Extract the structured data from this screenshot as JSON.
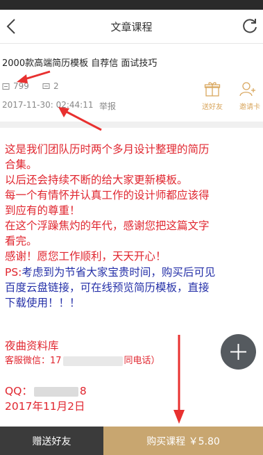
{
  "header": {
    "title": "文章课程",
    "back_icon": "chevron-left-icon",
    "refresh_icon": "refresh-icon"
  },
  "course": {
    "title": "2000款高端简历模板 自荐信 面试技巧",
    "views": "799",
    "comments": "2",
    "datetime": "2017-11-30: 02:44:11",
    "report": "举报",
    "gift_label": "送好友",
    "invite_label": "邀请卡"
  },
  "content": {
    "line1": "这是我们团队历时两个多月设计整理的简历",
    "line2": "合集。",
    "line3": "以后还会持续不断的给大家更新模板。",
    "line4": "每一个有情怀并认真工作的设计师都应该得",
    "line5": "到应有的尊重！",
    "line6": "在这个浮躁焦灼的年代，感谢您把这篇文字",
    "line7": "看完。",
    "line8": "感谢！愿您工作顺利，天天开心！",
    "ps_prefix": "PS:",
    "ps_line1": "考虑到为节省大家宝贵时间，购买后可见",
    "ps_line2": "百度云盘链接，可在线预览简历模板，直接",
    "ps_line3": "下载使用！！！",
    "shop_name": "夜曲资料库",
    "wechat_prefix": "客服微信：17",
    "wechat_suffix": "同电话）",
    "qq_prefix": "QQ：",
    "qq_suffix": "8",
    "date": "2017年11月2日"
  },
  "bottom_bar": {
    "gift_button": "赠送好友",
    "buy_button": "购买课程 ￥5.80"
  },
  "colors": {
    "red_text": "#e0262f",
    "blue_text": "#2530a8",
    "gold": "#c8a670",
    "dark": "#3b3b3b"
  }
}
